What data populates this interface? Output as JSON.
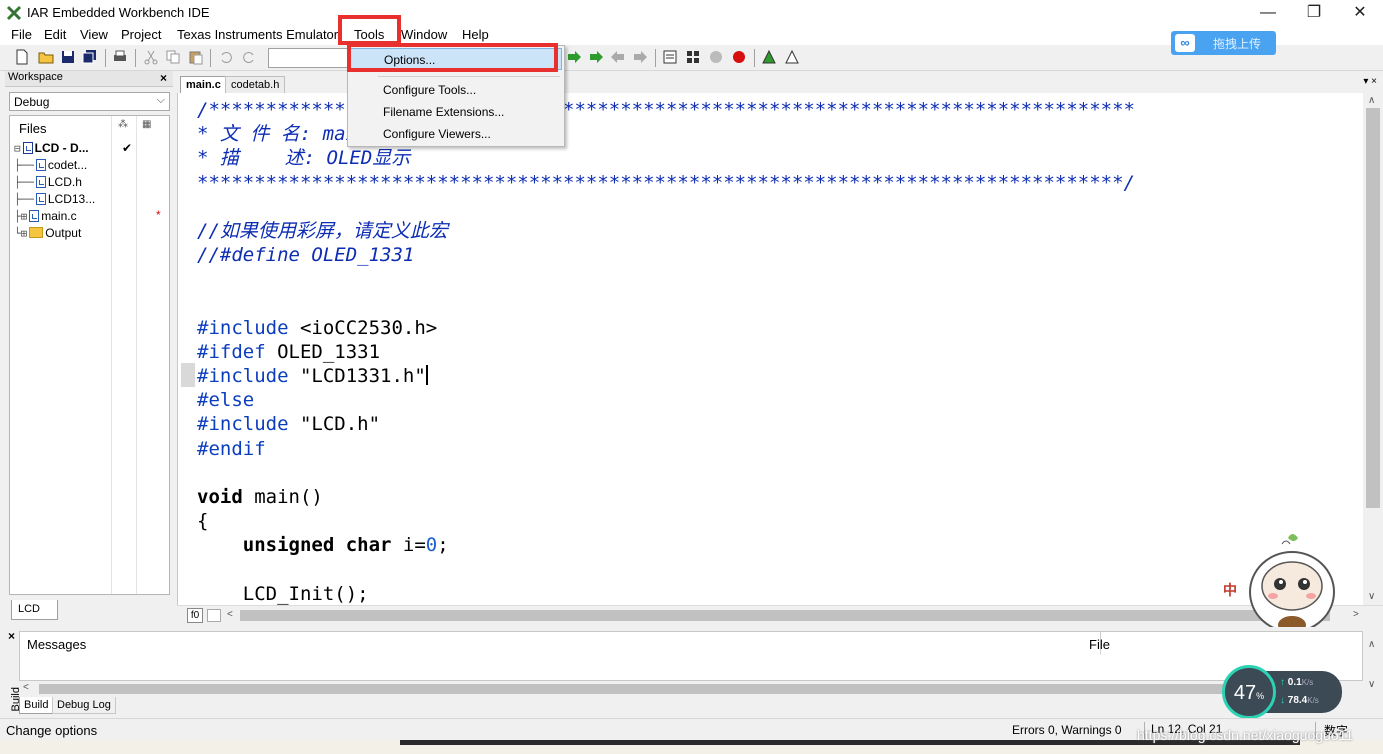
{
  "window": {
    "title": "IAR Embedded Workbench IDE",
    "minimize": "—",
    "restore": "❐",
    "close": "✕"
  },
  "menu": [
    "File",
    "Edit",
    "View",
    "Project",
    "Texas Instruments Emulator",
    "Tools",
    "Window",
    "Help"
  ],
  "upload_button": {
    "label": "拖拽上传"
  },
  "workspace": {
    "title": "Workspace",
    "close": "×",
    "config": "Debug",
    "files_header": "Files",
    "tree": [
      {
        "prefix": "⊟",
        "label": "LCD - D...",
        "mark": "✔",
        "kind": "project"
      },
      {
        "prefix": "├──",
        "label": "codet...",
        "kind": "file"
      },
      {
        "prefix": "├──",
        "label": "LCD.h",
        "kind": "file"
      },
      {
        "prefix": "├──",
        "label": "LCD13...",
        "kind": "file"
      },
      {
        "prefix": "├⊞",
        "label": "main.c",
        "mark": "*",
        "kind": "file"
      },
      {
        "prefix": "└⊞",
        "label": "Output",
        "kind": "folder"
      }
    ],
    "tab": "LCD"
  },
  "editor": {
    "tabs": [
      "main.c",
      "codetab.h"
    ],
    "fo_label": "f0"
  },
  "code": [
    {
      "type": "comment",
      "text": "/*********************************************************************************"
    },
    {
      "type": "comment",
      "text": "* 文 件 名: main.c"
    },
    {
      "type": "comment",
      "text": "* 描    述: OLED显示"
    },
    {
      "type": "comment",
      "text": "*********************************************************************************/"
    },
    {
      "type": "blank",
      "text": ""
    },
    {
      "type": "comment",
      "text": "//如果使用彩屏，请定义此宏"
    },
    {
      "type": "comment",
      "text": "//#define OLED_1331"
    },
    {
      "type": "blank",
      "text": ""
    },
    {
      "type": "blank",
      "text": ""
    },
    {
      "type": "pre",
      "text": "#include",
      "rest": " <ioCC2530.h>"
    },
    {
      "type": "pre",
      "text": "#ifdef",
      "rest": " OLED_1331"
    },
    {
      "type": "pre",
      "text": "#include",
      "rest": " \"LCD1331.h\"",
      "caret": true
    },
    {
      "type": "pre",
      "text": "#else",
      "rest": ""
    },
    {
      "type": "pre",
      "text": "#include",
      "rest": " \"LCD.h\""
    },
    {
      "type": "pre",
      "text": "#endif",
      "rest": ""
    },
    {
      "type": "blank",
      "text": ""
    },
    {
      "type": "kw",
      "text": "void",
      "rest": " main()"
    },
    {
      "type": "plain",
      "text": "{"
    },
    {
      "type": "decl",
      "text": "    unsigned char",
      "rest": " i=",
      "num": "0",
      "tail": ";"
    },
    {
      "type": "blank",
      "text": ""
    },
    {
      "type": "plain",
      "text": "    LCD_Init();"
    }
  ],
  "tools_menu": {
    "items": [
      "Options...",
      "Configure Tools...",
      "Filename Extensions...",
      "Configure Viewers..."
    ],
    "selected": "Options..."
  },
  "build": {
    "vertical_label": "Build",
    "close": "×",
    "messages_header": "Messages",
    "file_header": "File",
    "tabs": [
      "Build",
      "Debug Log"
    ]
  },
  "status": {
    "text": "Change options",
    "errors": "Errors 0, Warnings 0",
    "cursor": "Ln 12, Col 21",
    "numlock": "数字"
  },
  "speed_widget": {
    "percent": "47",
    "percent_unit": "%",
    "up": "0.1",
    "down": "78.4",
    "unit": "K/s"
  },
  "ime": "中",
  "watermark": "https://blog.csdn.net/xiaoguoguo11",
  "colors": {
    "highlight_red": "#e8312f",
    "comment_blue": "#0d2db3",
    "accent_blue": "#4aa3f0",
    "speed_ring": "#2bd3b4"
  }
}
